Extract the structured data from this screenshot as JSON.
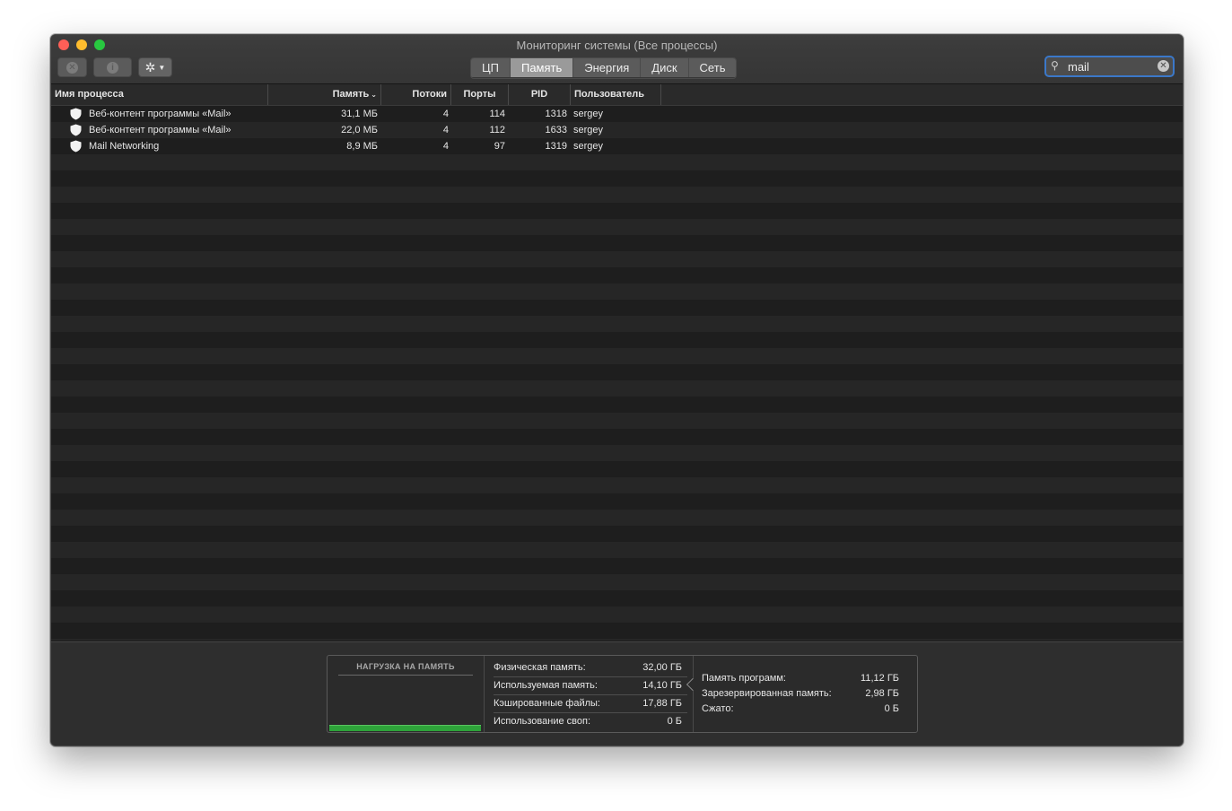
{
  "window": {
    "title": "Мониторинг системы (Все процессы)"
  },
  "toolbar": {
    "quit_icon": "close-x-icon",
    "info_icon": "info-icon",
    "gear_icon": "gear-icon",
    "tabs": [
      {
        "label": "ЦП",
        "active": false
      },
      {
        "label": "Память",
        "active": true
      },
      {
        "label": "Энергия",
        "active": false
      },
      {
        "label": "Диск",
        "active": false
      },
      {
        "label": "Сеть",
        "active": false
      }
    ],
    "search": {
      "value": "mail",
      "placeholder": "Поиск"
    }
  },
  "table": {
    "columns": {
      "name": "Имя процесса",
      "memory": "Память",
      "threads": "Потоки",
      "ports": "Порты",
      "pid": "PID",
      "user": "Пользователь"
    },
    "rows": [
      {
        "name": "Веб-контент программы «Mail»",
        "memory": "31,1 МБ",
        "threads": "4",
        "ports": "114",
        "pid": "1318",
        "user": "sergey"
      },
      {
        "name": "Веб-контент программы «Mail»",
        "memory": "22,0 МБ",
        "threads": "4",
        "ports": "112",
        "pid": "1633",
        "user": "sergey"
      },
      {
        "name": "Mail Networking",
        "memory": "8,9 МБ",
        "threads": "4",
        "ports": "97",
        "pid": "1319",
        "user": "sergey"
      }
    ]
  },
  "memory_panel": {
    "pressure_title": "НАГРУЗКА НА ПАМЯТЬ",
    "pressure_color": "#2ea33a",
    "stats": [
      {
        "label": "Физическая память:",
        "value": "32,00 ГБ"
      },
      {
        "label": "Используемая память:",
        "value": "14,10 ГБ"
      },
      {
        "label": "Кэшированные файлы:",
        "value": "17,88 ГБ"
      },
      {
        "label": "Использование своп:",
        "value": "0 Б"
      }
    ],
    "details": [
      {
        "label": "Память программ:",
        "value": "11,12 ГБ"
      },
      {
        "label": "Зарезервированная память:",
        "value": "2,98 ГБ"
      },
      {
        "label": "Сжато:",
        "value": "0 Б"
      }
    ]
  }
}
